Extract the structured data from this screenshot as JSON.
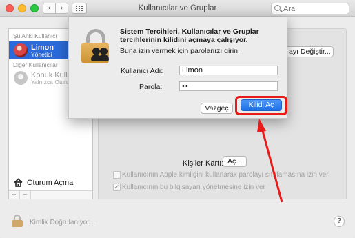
{
  "window": {
    "title": "Kullanıcılar ve Gruplar",
    "nav_back": "‹",
    "nav_forward": "›"
  },
  "search": {
    "placeholder": "Ara"
  },
  "sidebar": {
    "current_section": "Şu Anki Kullanıcı",
    "other_section": "Diğer Kullanıcılar",
    "users": [
      {
        "name": "Limon",
        "role": "Yönetici",
        "selected": true
      },
      {
        "name": "Konuk Kullan",
        "role": "Yalnızca Oturu",
        "selected": false
      }
    ],
    "login_options": "Oturum Açma",
    "add": "+",
    "remove": "−"
  },
  "main": {
    "change_password": "ayı Değiştir...",
    "contact_card_label": "Kişiler Kartı:",
    "contact_card_button": "Aç...",
    "checkboxes": [
      {
        "label": "Kullanıcının Apple kimliğini kullanarak parolayı sıfırlamasına izin ver",
        "checked": false
      },
      {
        "label": "Kullanıcının bu bilgisayarı yönetmesine izin ver",
        "checked": true
      }
    ]
  },
  "bottom": {
    "lock_label": "Kimlik Doğrulanıyor...",
    "help": "?"
  },
  "auth_sheet": {
    "title": "Sistem Tercihleri, Kullanıcılar ve Gruplar tercihlerinin kilidini açmaya çalışıyor.",
    "message": "Buna izin vermek için parolanızı girin.",
    "username_label": "Kullanıcı Adı:",
    "username_value": "Limon",
    "password_label": "Parola:",
    "password_value": "••",
    "cancel_button": "Vazgeç",
    "unlock_button": "Kilidi Aç"
  },
  "colors": {
    "selection_blue": "#2a6ad9",
    "default_button_blue": "#1e6fe8",
    "annotation_red": "#e81a1a"
  }
}
